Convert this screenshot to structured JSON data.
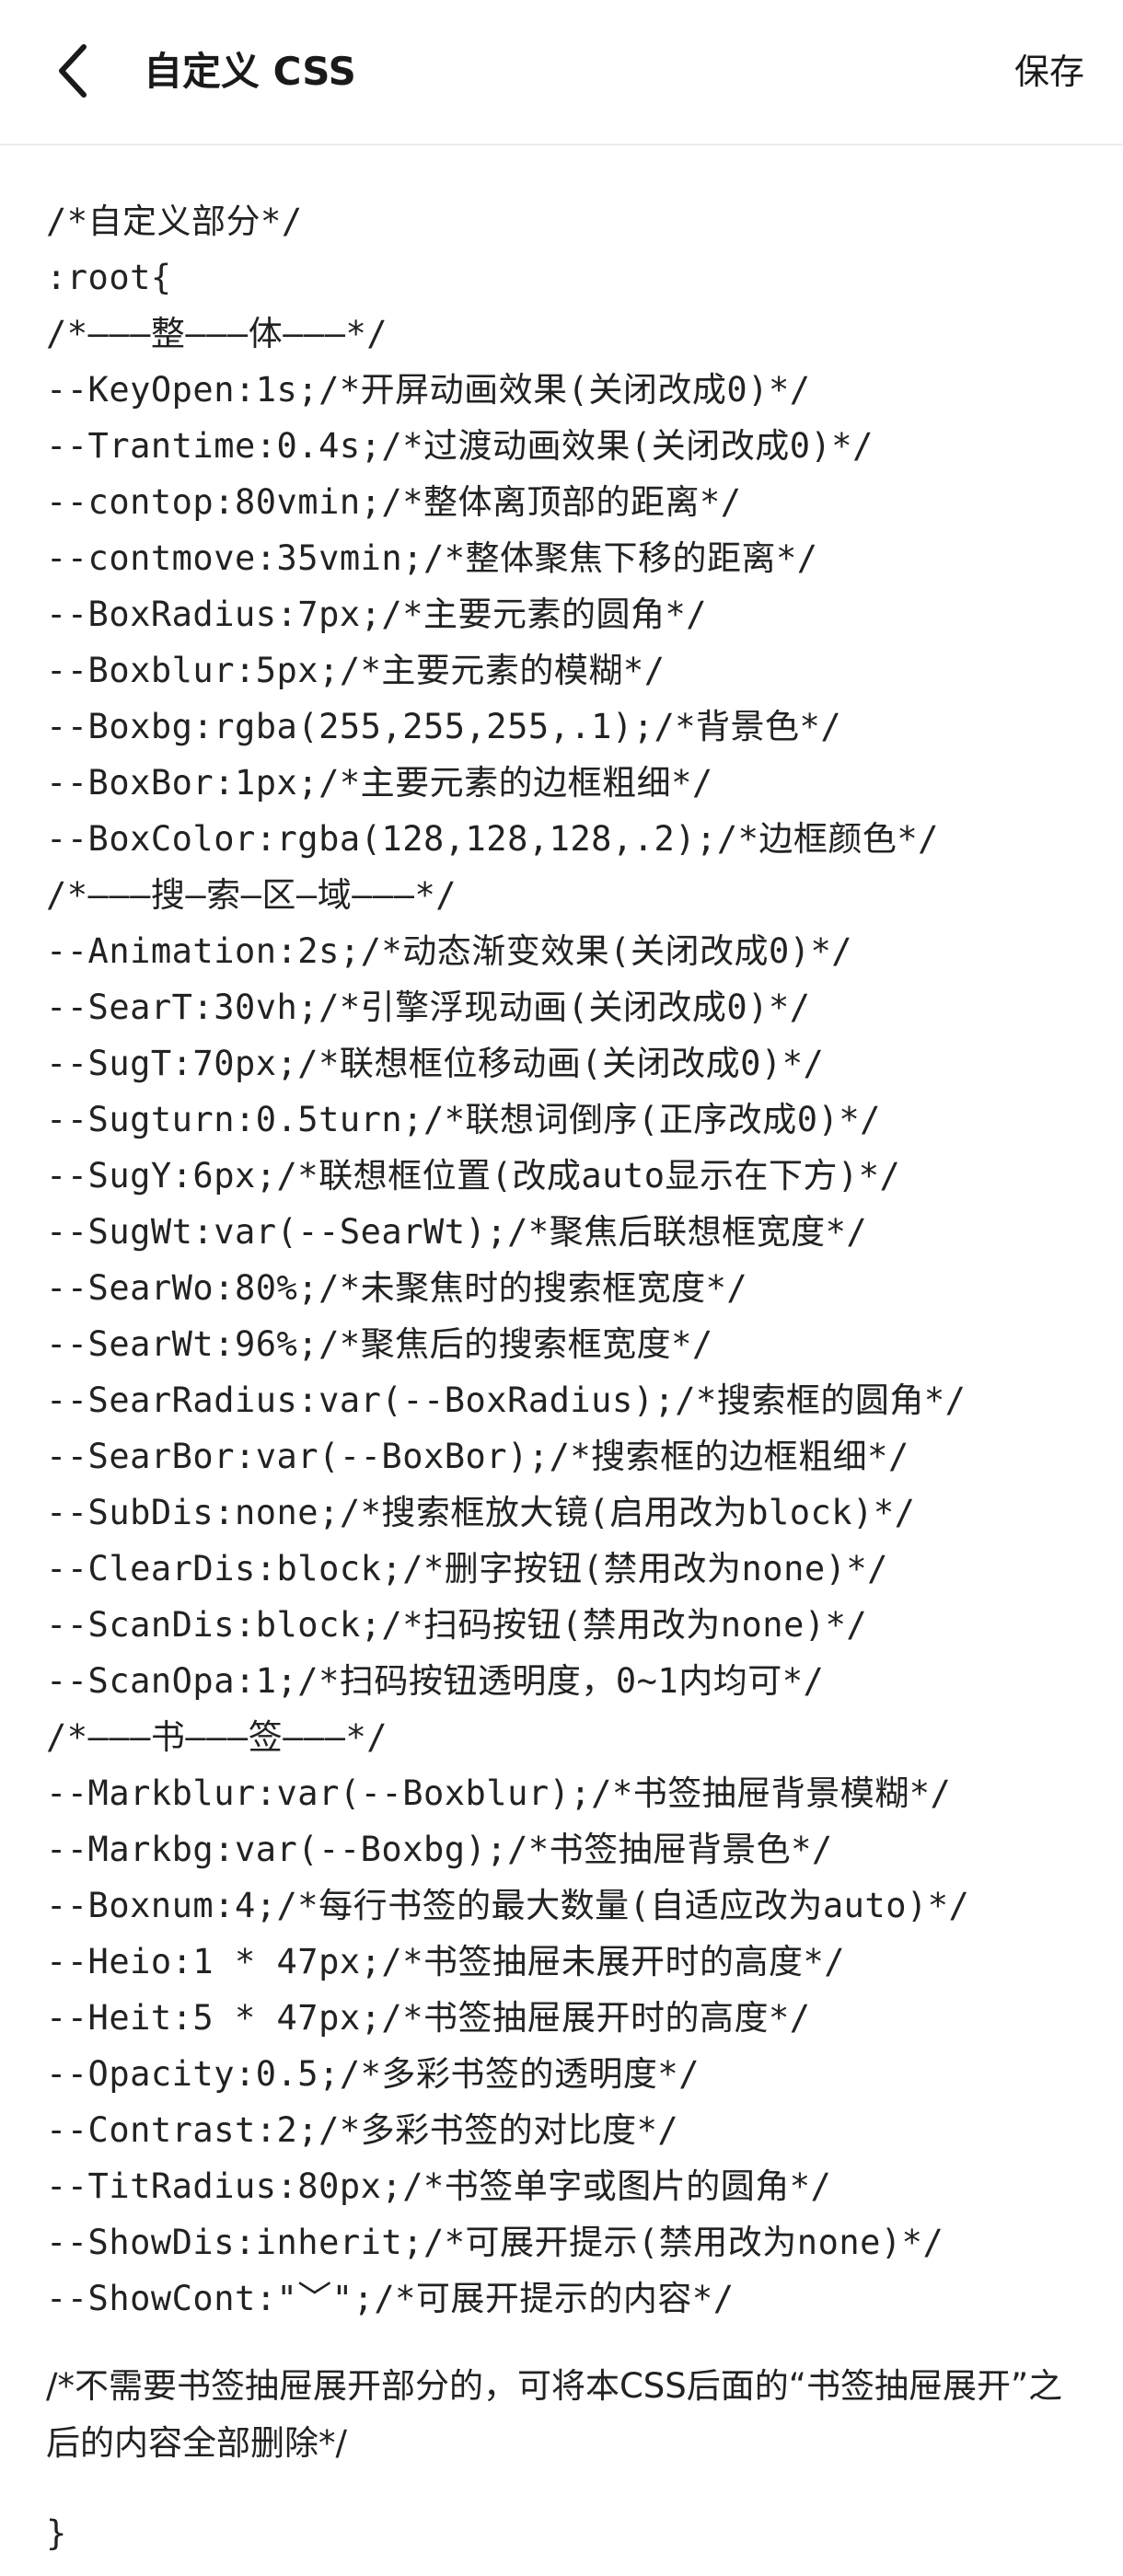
{
  "header": {
    "back_icon": "chevron-left-icon",
    "title": "自定义 CSS",
    "save_label": "保存"
  },
  "editor": {
    "lines": [
      "/*自定义部分*/",
      ":root{",
      "/*———整———体———*/",
      "--KeyOpen:1s;/*开屏动画效果(关闭改成0)*/",
      "--Trantime:0.4s;/*过渡动画效果(关闭改成0)*/",
      "--contop:80vmin;/*整体离顶部的距离*/",
      "--contmove:35vmin;/*整体聚焦下移的距离*/",
      "--BoxRadius:7px;/*主要元素的圆角*/",
      "--Boxblur:5px;/*主要元素的模糊*/",
      "--Boxbg:rgba(255,255,255,.1);/*背景色*/",
      "--BoxBor:1px;/*主要元素的边框粗细*/",
      "--BoxColor:rgba(128,128,128,.2);/*边框颜色*/",
      "/*———搜—索—区—域———*/",
      "--Animation:2s;/*动态渐变效果(关闭改成0)*/",
      "--SearT:30vh;/*引擎浮现动画(关闭改成0)*/",
      "--SugT:70px;/*联想框位移动画(关闭改成0)*/",
      "--Sugturn:0.5turn;/*联想词倒序(正序改成0)*/",
      "--SugY:6px;/*联想框位置(改成auto显示在下方)*/",
      "--SugWt:var(--SearWt);/*聚焦后联想框宽度*/",
      "--SearWo:80%;/*未聚焦时的搜索框宽度*/",
      "--SearWt:96%;/*聚焦后的搜索框宽度*/",
      "--SearRadius:var(--BoxRadius);/*搜索框的圆角*/",
      "--SearBor:var(--BoxBor);/*搜索框的边框粗细*/",
      "--SubDis:none;/*搜索框放大镜(启用改为block)*/",
      "--ClearDis:block;/*删字按钮(禁用改为none)*/",
      "--ScanDis:block;/*扫码按钮(禁用改为none)*/",
      "--ScanOpa:1;/*扫码按钮透明度，0~1内均可*/",
      "/*———书———签———*/",
      "--Markblur:var(--Boxblur);/*书签抽屉背景模糊*/",
      "--Markbg:var(--Boxbg);/*书签抽屉背景色*/",
      "--Boxnum:4;/*每行书签的最大数量(自适应改为auto)*/",
      "--Heio:1 * 47px;/*书签抽屉未展开时的高度*/",
      "--Heit:5 * 47px;/*书签抽屉展开时的高度*/",
      "--Opacity:0.5;/*多彩书签的透明度*/",
      "--Contrast:2;/*多彩书签的对比度*/",
      "--TitRadius:80px;/*书签单字或图片的圆角*/",
      "--ShowDis:inherit;/*可展开提示(禁用改为none)*/",
      "--ShowCont:\"﹀\";/*可展开提示的内容*/"
    ],
    "note": "/*不需要书签抽屉展开部分的，可将本CSS后面的“书签抽屉展开”之后的内容全部删除*/",
    "closing": "}"
  }
}
